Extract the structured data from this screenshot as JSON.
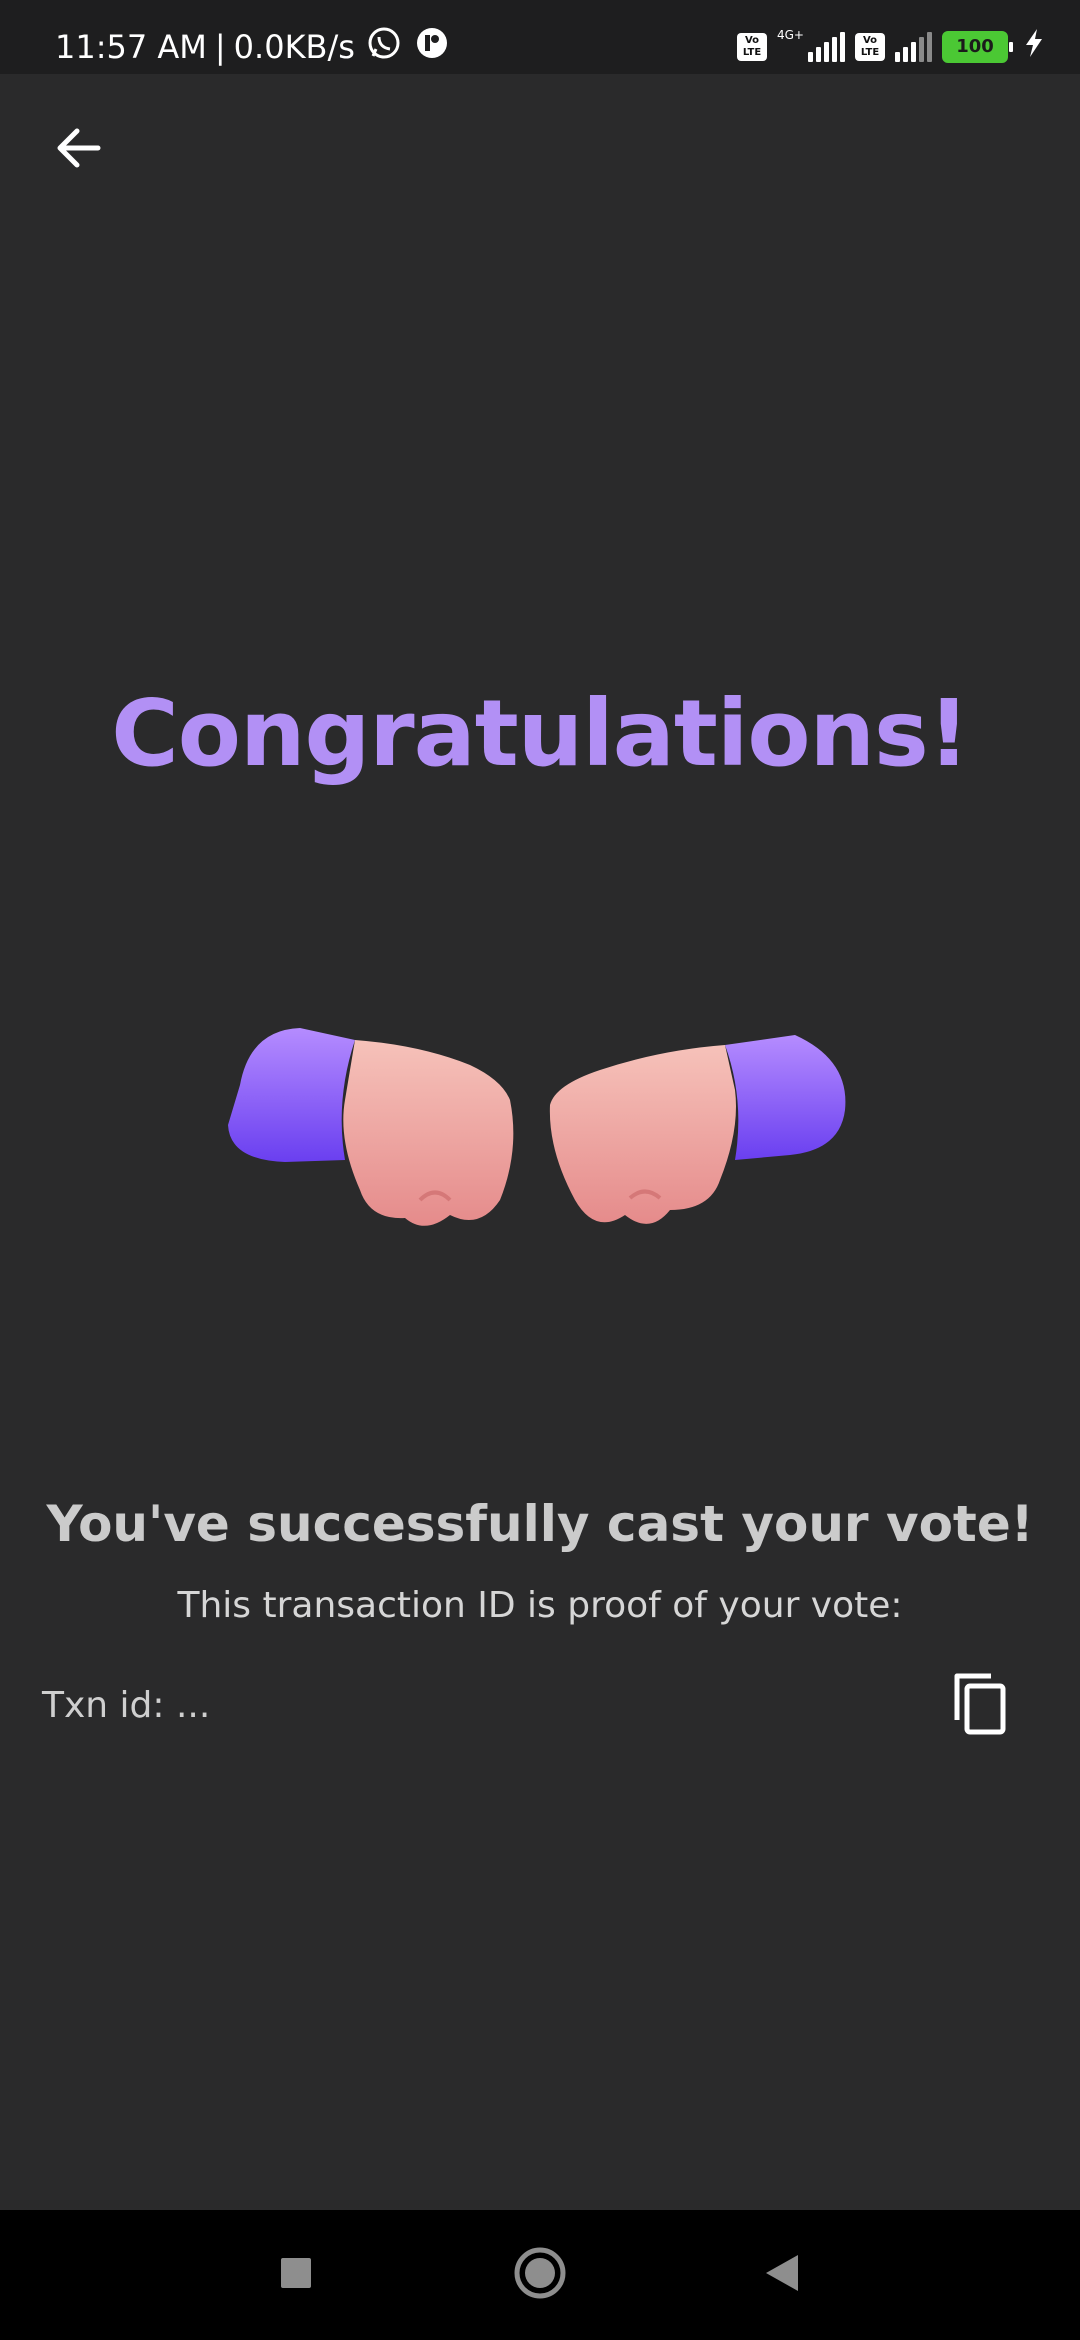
{
  "status_bar": {
    "time": "11:57 AM",
    "separator": "|",
    "net_speed": "0.0KB/s",
    "icons": [
      "whatsapp-icon",
      "app-notification-icon",
      "volte-icon",
      "signal-4g-icon",
      "volte-icon",
      "signal-icon",
      "battery-icon",
      "charging-icon"
    ],
    "volte_label_top": "Vo",
    "volte_label_bottom": "LTE",
    "network_type": "4G+",
    "battery": "100",
    "battery_color": "#4bc834"
  },
  "header": {
    "back_icon": "arrow-left-icon"
  },
  "main": {
    "headline": "Congratulations!",
    "headline_color": "#b290f5",
    "illustration_icon": "fist-bump-icon",
    "success_title": "You've successfully cast your vote!",
    "subtitle": "This transaction ID is proof of your vote:",
    "txn_label": "Txn id: ...",
    "copy_icon": "copy-icon"
  },
  "nav_bar": {
    "icons": [
      "recents-square-icon",
      "home-circle-icon",
      "back-triangle-icon"
    ]
  }
}
